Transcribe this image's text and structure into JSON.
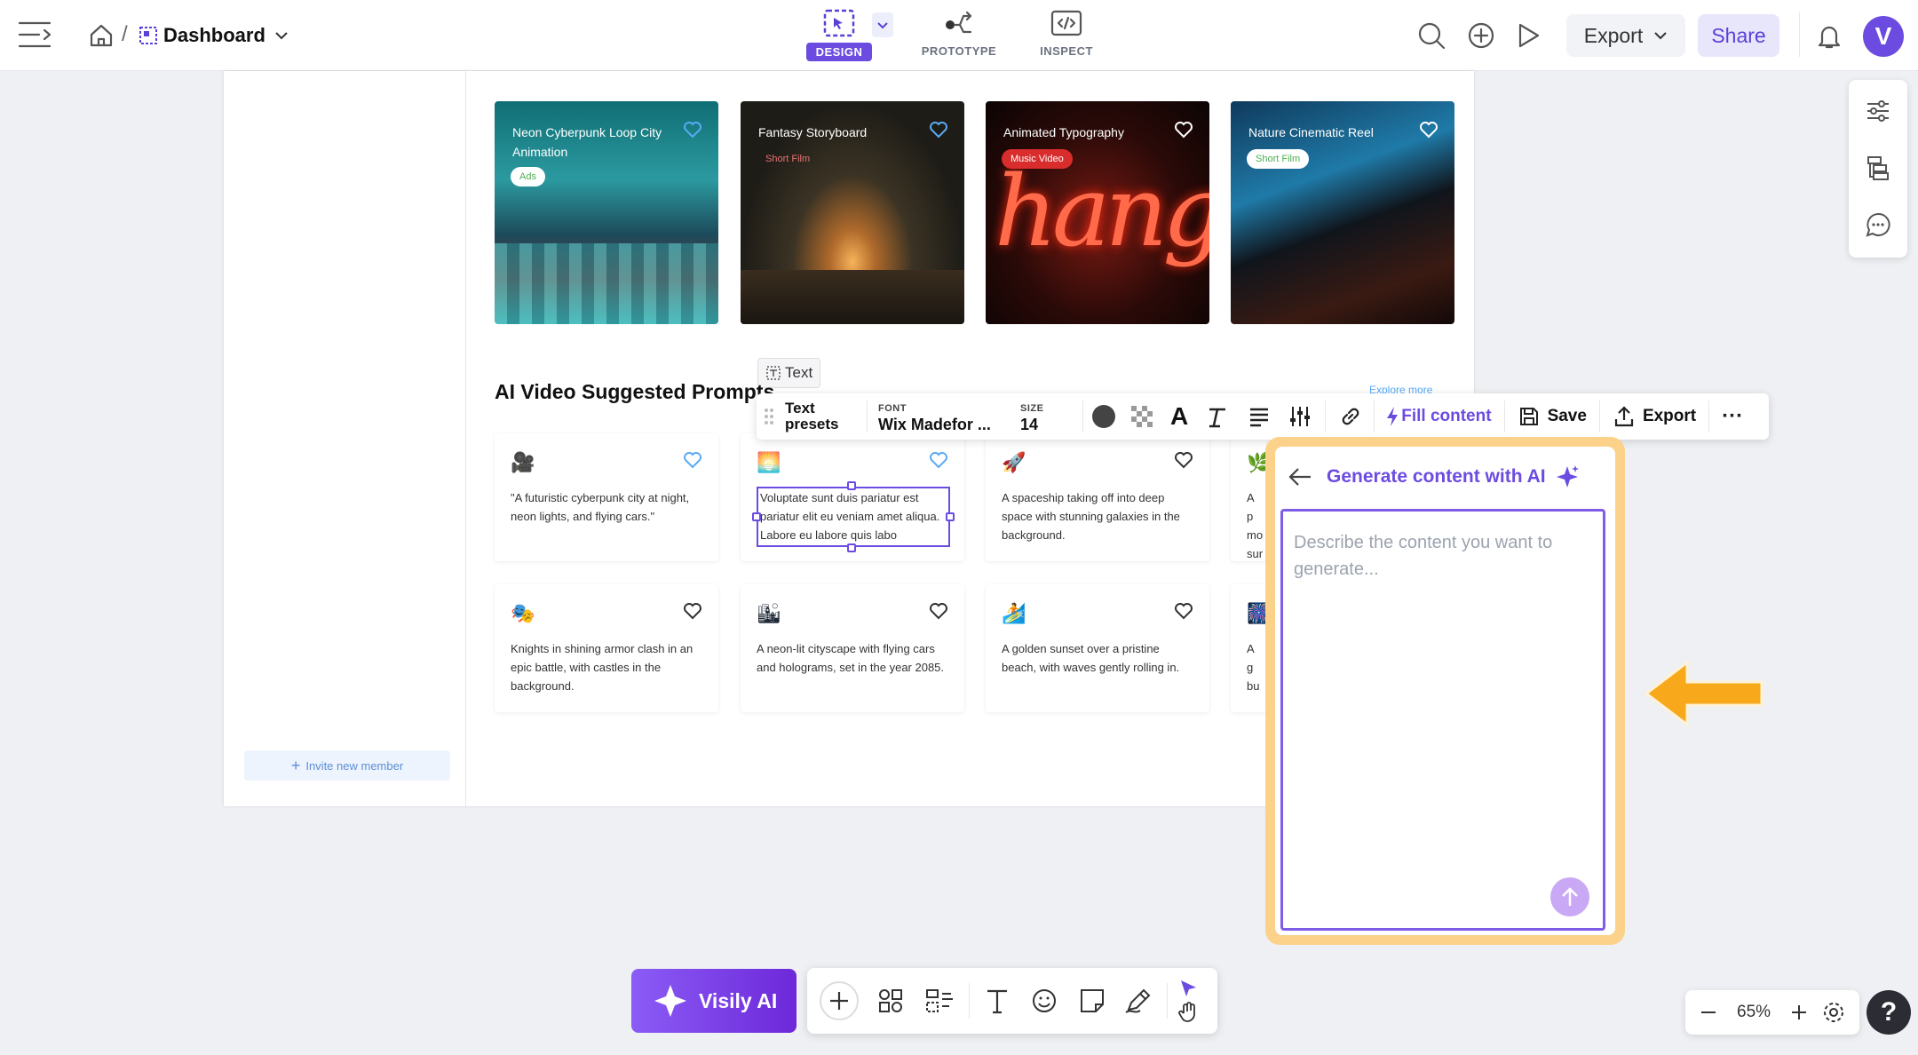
{
  "header": {
    "breadcrumb_sep": "/",
    "dashboard_label": "Dashboard",
    "modes": [
      {
        "label": "DESIGN",
        "active": true
      },
      {
        "label": "PROTOTYPE",
        "active": false
      },
      {
        "label": "INSPECT",
        "active": false
      }
    ],
    "export_label": "Export",
    "share_label": "Share",
    "avatar_letter": "V"
  },
  "featured_cards": [
    {
      "title": "Neon Cyberpunk Loop City Animation",
      "tag": "Ads",
      "tag_color": "#4caf50",
      "liked": true
    },
    {
      "title": "Fantasy Storyboard",
      "tag": "Short Film",
      "tag_color": "#e57373",
      "liked": true
    },
    {
      "title": "Animated Typography",
      "tag": "Music Video",
      "tag_color": "#ffffff",
      "liked": false
    },
    {
      "title": "Nature Cinematic Reel",
      "tag": "Short Film",
      "tag_color": "#4caf50",
      "liked": false
    }
  ],
  "section": {
    "title": "AI Video Suggested Prompts",
    "explore": "Explore more"
  },
  "text_tag": "Text",
  "prompt_cards_row1": [
    {
      "emoji": "🎥",
      "text": "\"A futuristic cyberpunk city at night, neon lights, and flying cars.\"",
      "liked": true
    },
    {
      "emoji": "🌅",
      "text": "Voluptate sunt duis pariatur est pariatur elit eu veniam amet aliqua. Labore eu labore quis labo",
      "liked": true
    },
    {
      "emoji": "🚀",
      "text": "A spaceship taking off into deep space with stunning galaxies in the background.",
      "liked": false
    },
    {
      "emoji": "🌿",
      "text": "A p mo sur",
      "liked": false
    }
  ],
  "prompt_cards_row2": [
    {
      "emoji": "🎭",
      "text": "Knights in shining armor clash in an epic battle, with castles in the background.",
      "liked": false
    },
    {
      "emoji": "🏙",
      "text": "A neon-lit cityscape with flying cars and holograms, set in the year 2085.",
      "liked": false
    },
    {
      "emoji": "🏄",
      "text": "A golden sunset over a pristine beach, with waves gently rolling in.",
      "liked": false
    },
    {
      "emoji": "🎆",
      "text": "A g bu",
      "liked": false
    }
  ],
  "invite_label": "Invite new member",
  "toolbar": {
    "presets_line1": "Text",
    "presets_line2": "presets",
    "font_label": "FONT",
    "font_value": "Wix Madefor ...",
    "size_label": "SIZE",
    "size_value": "14",
    "fill_content": "Fill content",
    "save": "Save",
    "export": "Export",
    "more": "···"
  },
  "ai_panel": {
    "title": "Generate content with AI",
    "placeholder": "Describe the content you want to generate..."
  },
  "visily_label": "Visily AI",
  "zoom": {
    "value": "65%"
  },
  "colors": {
    "accent": "#6c4ce0",
    "ai_border": "#fcd28a",
    "arrow": "#f7a81b"
  }
}
